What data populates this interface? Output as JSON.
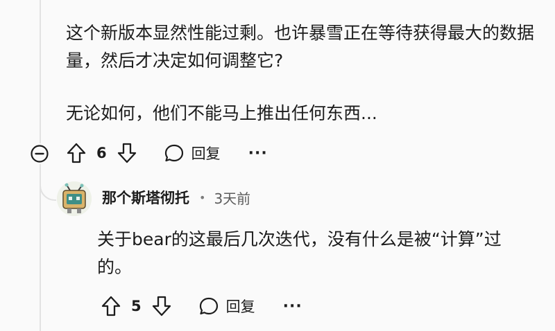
{
  "comment": {
    "body": [
      "这个新版本显然性能过剩。也许暴雪正在等待获得最大的数据量，然后才决定如何调整它?",
      "无论如何，他们不能马上推出任何东西..."
    ],
    "score": "6",
    "reply_label": "回复",
    "more_label": "···"
  },
  "reply": {
    "author": "那个斯塔彻托",
    "separator": "•",
    "time": "3天前",
    "body": "关于bear的这最后几次迭代，没有什么是被“计算”过的。",
    "score": "5",
    "reply_label": "回复",
    "more_label": "···"
  },
  "icons": {
    "collapse": "minus-circle-icon",
    "upvote": "arrow-up-icon",
    "downvote": "arrow-down-icon",
    "reply": "speech-bubble-icon",
    "more": "ellipsis-icon"
  }
}
